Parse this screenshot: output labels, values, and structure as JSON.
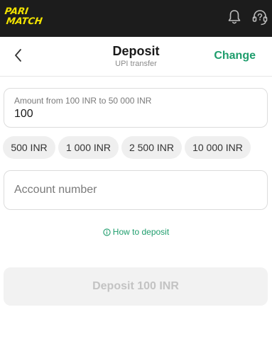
{
  "topbar": {
    "logo_top": "PARI",
    "logo_bottom": "MATCH",
    "logo_color": "#f2e300",
    "bg_color": "#1c1c1c",
    "bell_icon": "bell-icon",
    "support_icon": "headset-support-icon"
  },
  "header": {
    "title": "Deposit",
    "subtitle": "UPI transfer",
    "change_label": "Change",
    "accent_color": "#1e9d6c"
  },
  "amount": {
    "label": "Amount from 100 INR to 50 000 INR",
    "value": "100"
  },
  "quick_amounts": [
    "500 INR",
    "1 000 INR",
    "2 500 INR",
    "10 000 INR"
  ],
  "account": {
    "placeholder": "Account number",
    "value": ""
  },
  "howto": {
    "label": "How to deposit",
    "icon": "info-icon"
  },
  "deposit_button": {
    "label": "Deposit 100 INR",
    "disabled": true
  }
}
